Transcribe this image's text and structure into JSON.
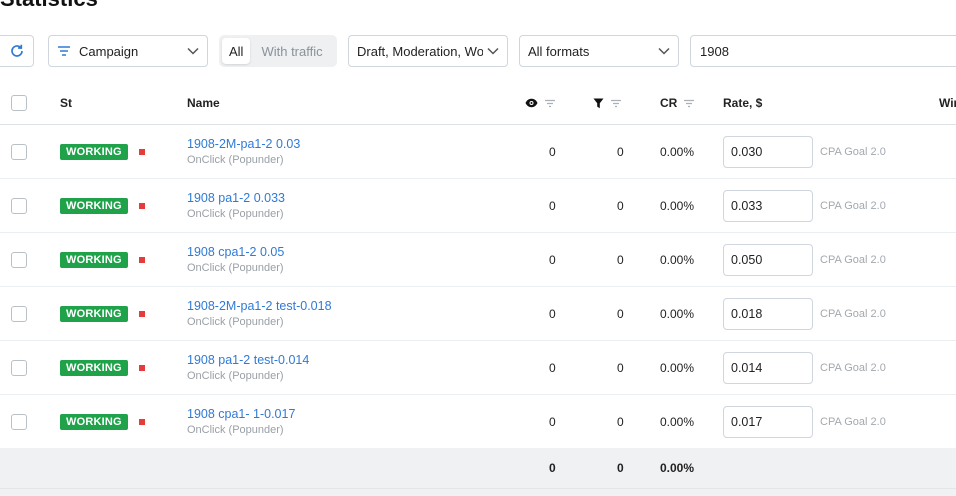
{
  "page": {
    "title": "Statistics"
  },
  "toolbar": {
    "refresh_icon": "refresh-icon",
    "campaign_select": "Campaign",
    "traffic_toggle": {
      "all": "All",
      "with_traffic": "With traffic",
      "selected": "All"
    },
    "status_select": "Draft, Moderation, Wo",
    "format_select": "All formats",
    "search_value": "1908"
  },
  "table": {
    "headers": {
      "status": "St",
      "name": "Name",
      "impressions_icon": "eye-icon",
      "conversions_icon": "funnel-icon",
      "cr": "CR",
      "rate": "Rate, $",
      "next": "Win"
    },
    "rows": [
      {
        "status": "WORKING",
        "name": "1908-2M-pa1-2  0.03",
        "sub": "OnClick (Popunder)",
        "impressions": "0",
        "conversions": "0",
        "cr": "0.00%",
        "rate": "0.030",
        "goal": "CPA Goal 2.0"
      },
      {
        "status": "WORKING",
        "name": "1908  pa1-2  0.033",
        "sub": "OnClick (Popunder)",
        "impressions": "0",
        "conversions": "0",
        "cr": "0.00%",
        "rate": "0.033",
        "goal": "CPA Goal 2.0"
      },
      {
        "status": "WORKING",
        "name": "1908  cpa1-2  0.05",
        "sub": "OnClick (Popunder)",
        "impressions": "0",
        "conversions": "0",
        "cr": "0.00%",
        "rate": "0.050",
        "goal": "CPA Goal 2.0"
      },
      {
        "status": "WORKING",
        "name": "1908-2M-pa1-2  test-0.018",
        "sub": "OnClick (Popunder)",
        "impressions": "0",
        "conversions": "0",
        "cr": "0.00%",
        "rate": "0.018",
        "goal": "CPA Goal 2.0"
      },
      {
        "status": "WORKING",
        "name": "1908  pa1-2  test-0.014",
        "sub": "OnClick (Popunder)",
        "impressions": "0",
        "conversions": "0",
        "cr": "0.00%",
        "rate": "0.014",
        "goal": "CPA Goal 2.0"
      },
      {
        "status": "WORKING",
        "name": "1908  cpa1-  1-0.017",
        "sub": "OnClick (Popunder)",
        "impressions": "0",
        "conversions": "0",
        "cr": "0.00%",
        "rate": "0.017",
        "goal": "CPA Goal 2.0"
      }
    ],
    "totals": {
      "impressions": "0",
      "conversions": "0",
      "cr": "0.00%"
    }
  },
  "colors": {
    "accent": "#2f7ad6",
    "working_badge": "#1fa24a",
    "status_dot": "#e43b3b",
    "footer_bg": "#f0f1f3"
  }
}
